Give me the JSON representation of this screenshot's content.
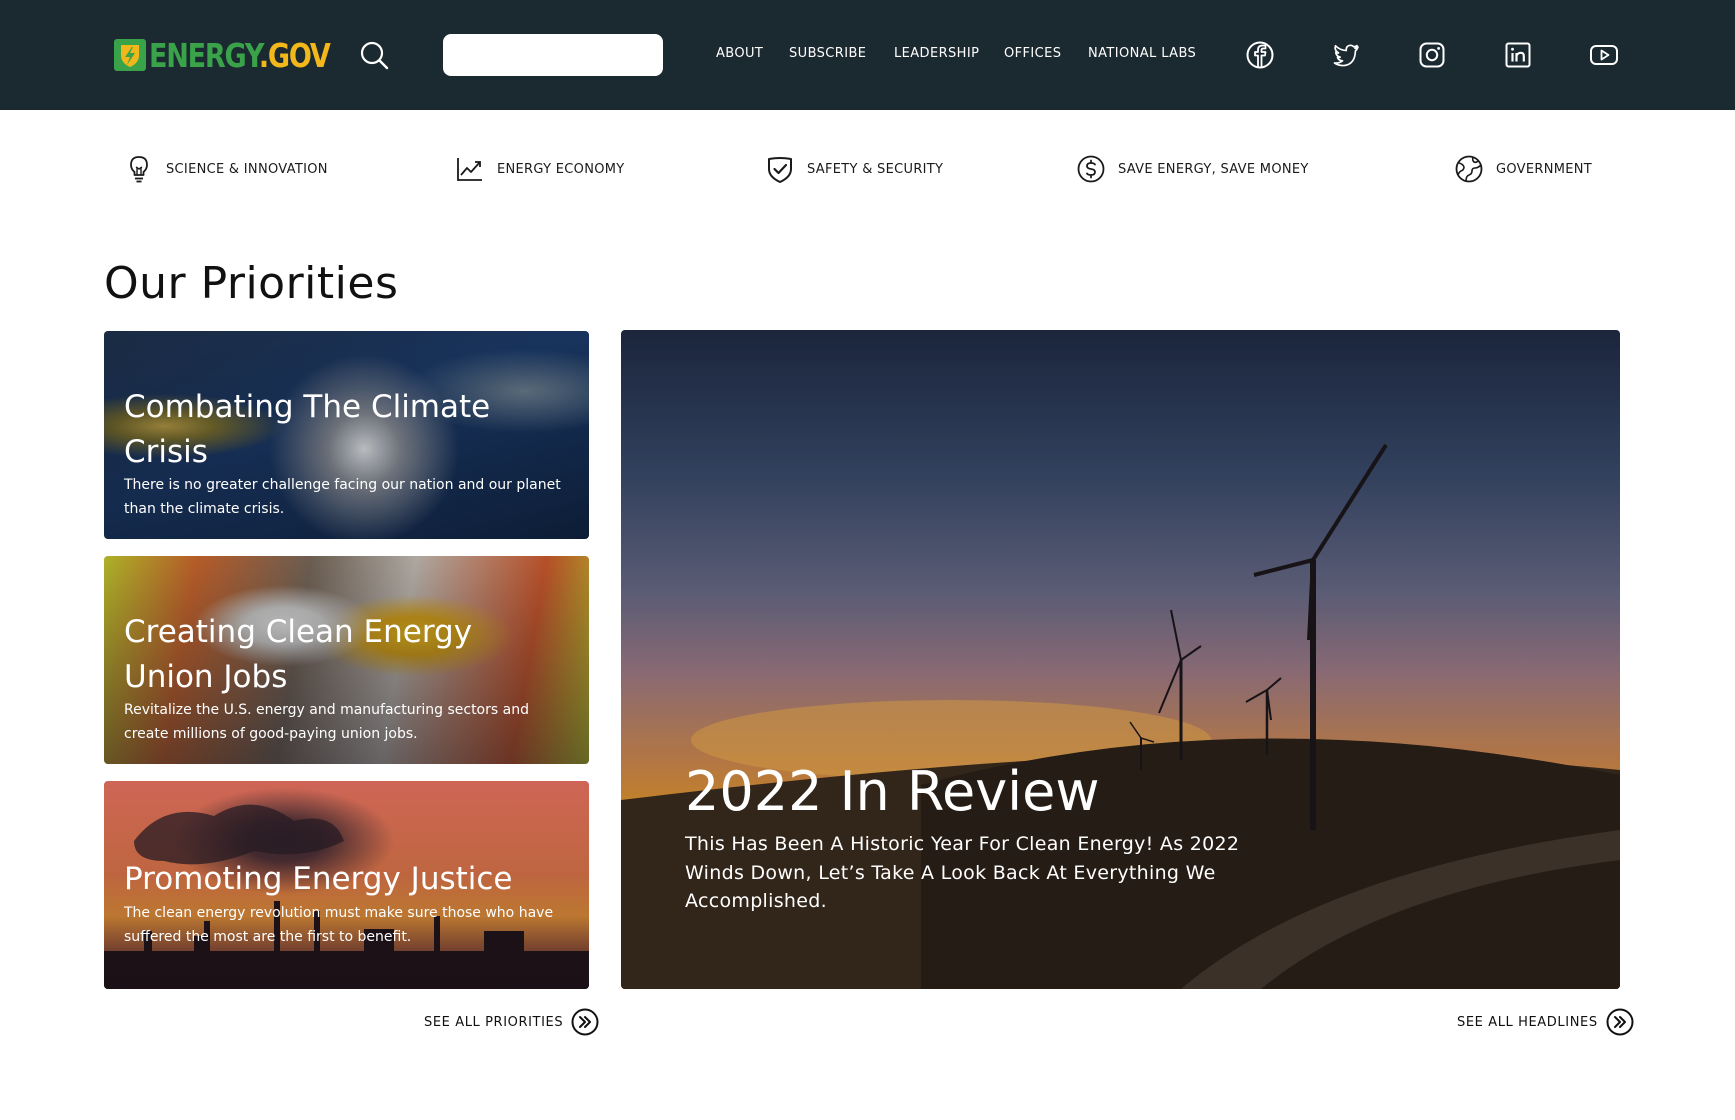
{
  "header": {
    "logo": {
      "part1": "ENERGY",
      "part2": ".GOV"
    },
    "search": {
      "placeholder": ""
    },
    "nav": [
      "ABOUT",
      "SUBSCRIBE",
      "LEADERSHIP",
      "OFFICES",
      "NATIONAL LABS"
    ],
    "social_icons": [
      "facebook-icon",
      "twitter-icon",
      "instagram-icon",
      "linkedin-icon",
      "youtube-icon"
    ]
  },
  "categories": [
    {
      "label": "SCIENCE & INNOVATION",
      "icon": "lightbulb-icon"
    },
    {
      "label": "ENERGY ECONOMY",
      "icon": "line-chart-icon"
    },
    {
      "label": "SAFETY & SECURITY",
      "icon": "shield-check-icon"
    },
    {
      "label": "SAVE ENERGY, SAVE MONEY",
      "icon": "dollar-circle-icon"
    },
    {
      "label": "GOVERNMENT",
      "icon": "globe-icon"
    }
  ],
  "priorities": {
    "title": "Our Priorities",
    "cards": [
      {
        "title": "Combating The Climate Crisis",
        "desc": "There is no greater challenge facing our nation and our planet than the climate crisis."
      },
      {
        "title": "Creating Clean Energy Union Jobs",
        "desc": "Revitalize the U.S. energy and manufacturing sectors and create millions of good-paying union jobs."
      },
      {
        "title": "Promoting Energy Justice",
        "desc": "The clean energy revolution must make sure those who have suffered the most are the first to benefit."
      }
    ],
    "see_all": "SEE ALL PRIORITIES"
  },
  "headline": {
    "title": "2022 In Review",
    "desc": "This Has Been A Historic Year For Clean Energy! As 2022 Winds Down, Let’s Take A Look Back At Everything We Accomplished.",
    "see_all": "SEE ALL HEADLINES"
  },
  "colors": {
    "header_bg": "#1b2930",
    "logo_green": "#3aa34a",
    "logo_gold": "#f2b71a"
  }
}
